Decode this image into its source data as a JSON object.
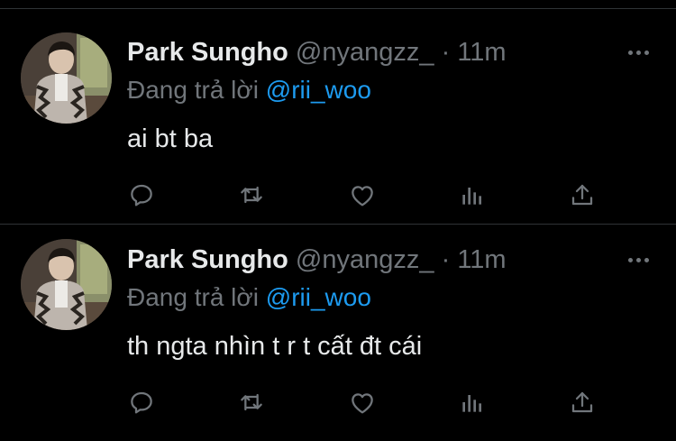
{
  "tweets": [
    {
      "display_name": "Park Sungho",
      "handle": "@nyangzz_",
      "separator": "·",
      "time": "11m",
      "reply_prefix": "Đang trả lời",
      "reply_to": "@rii_woo",
      "text": "ai bt ba"
    },
    {
      "display_name": "Park Sungho",
      "handle": "@nyangzz_",
      "separator": "·",
      "time": "11m",
      "reply_prefix": "Đang trả lời",
      "reply_to": "@rii_woo",
      "text": "th ngta nhìn t r t cất đt cái"
    }
  ],
  "icons": [
    "reply-icon",
    "retweet-icon",
    "like-icon",
    "analytics-icon",
    "share-icon",
    "more-icon"
  ],
  "colors": {
    "background": "#000000",
    "text_primary": "#e7e9ea",
    "text_secondary": "#71767b",
    "accent": "#1d9bf0",
    "divider": "#2f3336"
  }
}
